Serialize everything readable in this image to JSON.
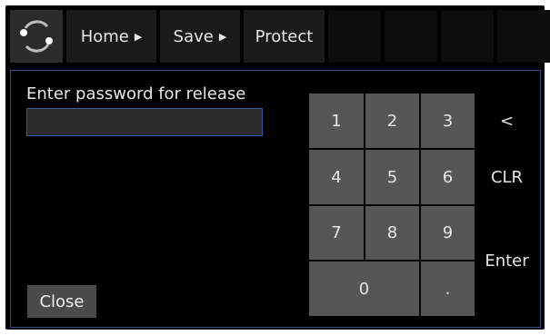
{
  "breadcrumb": {
    "items": [
      "Home",
      "Save",
      "Protect"
    ],
    "separator": "▶"
  },
  "dialog": {
    "prompt": "Enter password for release",
    "password_value": "",
    "close_label": "Close"
  },
  "keypad": {
    "keys": [
      "1",
      "2",
      "3",
      "4",
      "5",
      "6",
      "7",
      "8",
      "9",
      "0",
      "."
    ],
    "backspace": "<",
    "clear": "CLR",
    "enter": "Enter"
  },
  "colors": {
    "background": "#000000",
    "key": "#565656",
    "panel_border": "#2f4f86",
    "field_border": "#3a5a9a"
  }
}
